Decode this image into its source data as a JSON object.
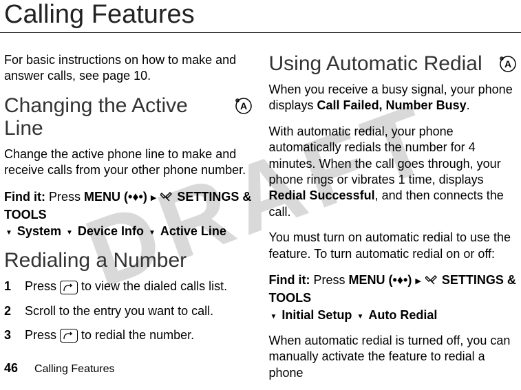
{
  "watermark": "DRAFT",
  "page_title": "Calling Features",
  "left": {
    "intro": "For basic instructions on how to make and answer calls, see page 10.",
    "sec1_heading": "Changing the Active Line",
    "sec1_body": "Change the active phone line to make and receive calls from your other phone number.",
    "find_it_label": "Find it:",
    "press_label": "Press",
    "menu_label": "MENU",
    "settings_tools": "SETTINGS & TOOLS",
    "system": "System",
    "device_info": "Device Info",
    "active_line": "Active Line",
    "sec2_heading": "Redialing a Number",
    "steps": [
      {
        "num": "1",
        "pre": "Press ",
        "post": " to view the dialed calls list."
      },
      {
        "num": "2",
        "pre": "Scroll to the entry you want to call.",
        "post": ""
      },
      {
        "num": "3",
        "pre": "Press ",
        "post": " to redial the number."
      }
    ]
  },
  "right": {
    "sec1_heading": "Using Automatic Redial",
    "p1a": "When you receive a busy signal, your phone displays ",
    "p1b": "Call Failed, Number Busy",
    "p1c": ".",
    "p2a": "With automatic redial, your phone automatically redials the number for 4 minutes. When the call goes through, your phone rings or vibrates 1 time, displays ",
    "p2b": "Redial Successful",
    "p2c": ", and then connects the call.",
    "p3": "You must turn on automatic redial to use the feature. To turn automatic redial on or off:",
    "find_it_label": "Find it:",
    "press_label": "Press",
    "menu_label": "MENU",
    "settings_tools": "SETTINGS & TOOLS",
    "initial_setup": "Initial Setup",
    "auto_redial": "Auto Redial",
    "p4": "When automatic redial is turned off, you can manually activate the feature to redial a phone"
  },
  "footer": {
    "page_number": "46",
    "section": "Calling Features"
  }
}
